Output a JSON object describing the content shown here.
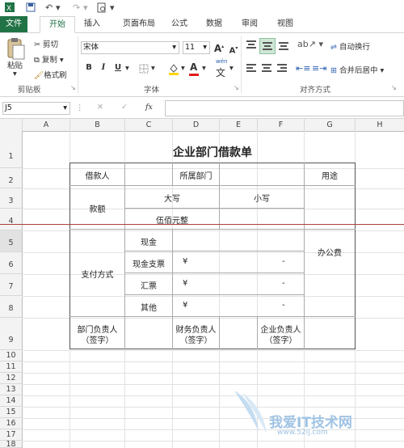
{
  "tabs": [
    "文件",
    "开始",
    "插入",
    "页面布局",
    "公式",
    "数据",
    "审阅",
    "视图"
  ],
  "ribbon": {
    "clipboard": {
      "paste": "粘贴",
      "cut": "剪切",
      "copy": "复制",
      "format_painter": "格式刷",
      "label": "剪贴板"
    },
    "font": {
      "name": "宋体",
      "size": "11",
      "grow": "A",
      "shrink": "A",
      "bold": "B",
      "italic": "I",
      "underline": "U",
      "wen": "wén",
      "label": "字体"
    },
    "alignment": {
      "wrap": "自动换行",
      "merge": "合并后居中",
      "label": "对齐方式"
    }
  },
  "formula_bar": {
    "name_box": "J5",
    "fx": "fx",
    "cancel": "✕",
    "enter": "✓"
  },
  "columns": [
    "A",
    "B",
    "C",
    "D",
    "E",
    "F",
    "G",
    "H"
  ],
  "rows": [
    "1",
    "2",
    "3",
    "4",
    "5",
    "6",
    "7",
    "8",
    "9",
    "10",
    "11",
    "12",
    "13",
    "14",
    "15",
    "16",
    "17",
    "18"
  ],
  "sheet": {
    "title": "企业部门借款单",
    "borrower": "借款人",
    "dept": "所属部门",
    "purpose": "用途",
    "amount": "款额",
    "upper": "大写",
    "lower": "小写",
    "upper_value": "伍佰元整",
    "pay_method": "支付方式",
    "cash": "现金",
    "cheque": "现金支票",
    "draft": "汇票",
    "other": "其他",
    "yen": "¥",
    "dash": "-",
    "office": "办公费",
    "dept_head_1": "部门负责人",
    "dept_head_2": "（签字）",
    "fin_head_1": "财务负责人",
    "fin_head_2": "（签字）",
    "corp_head_1": "企业负责人",
    "corp_head_2": "（签字）"
  },
  "watermark": {
    "text": "我爱IT技术网",
    "url": "www.52ij.com"
  }
}
